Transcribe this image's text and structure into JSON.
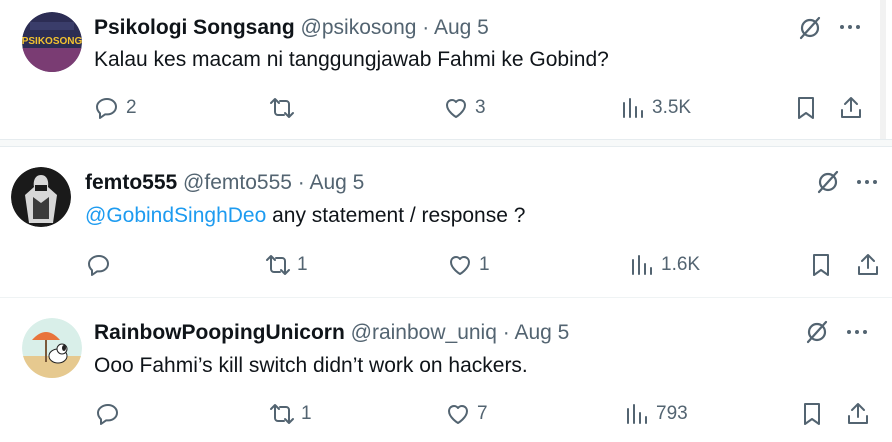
{
  "tweets": [
    {
      "name": "Psikologi Songsang",
      "handle": "@psikosong",
      "dot": "·",
      "date": "Aug 5",
      "text": "Kalau kes macam ni tanggungjawab Fahmi ke Gobind?",
      "mention": "",
      "avatar_text": "PSIKOSONG",
      "replies": "2",
      "reposts": "",
      "likes": "3",
      "views": "3.5K"
    },
    {
      "name": "femto555",
      "handle": "@femto555",
      "dot": "·",
      "date": "Aug 5",
      "mention": "@GobindSinghDeo",
      "text": " any statement / response ?",
      "replies": "",
      "reposts": "1",
      "likes": "1",
      "views": "1.6K"
    },
    {
      "name": "RainbowPoopingUnicorn",
      "handle": "@rainbow_uniq",
      "dot": "·",
      "date": "Aug 5",
      "mention": "",
      "text": "Ooo Fahmi’s kill switch didn’t work on hackers.",
      "replies": "",
      "reposts": "1",
      "likes": "7",
      "views": "793"
    }
  ],
  "colors": {
    "text": "#0f1419",
    "muted": "#536471",
    "link": "#1d9bf0",
    "divider": "#eff3f4"
  },
  "icons": [
    "reply-icon",
    "repost-icon",
    "like-icon",
    "views-icon",
    "bookmark-icon",
    "share-icon",
    "grok-icon",
    "more-icon"
  ]
}
